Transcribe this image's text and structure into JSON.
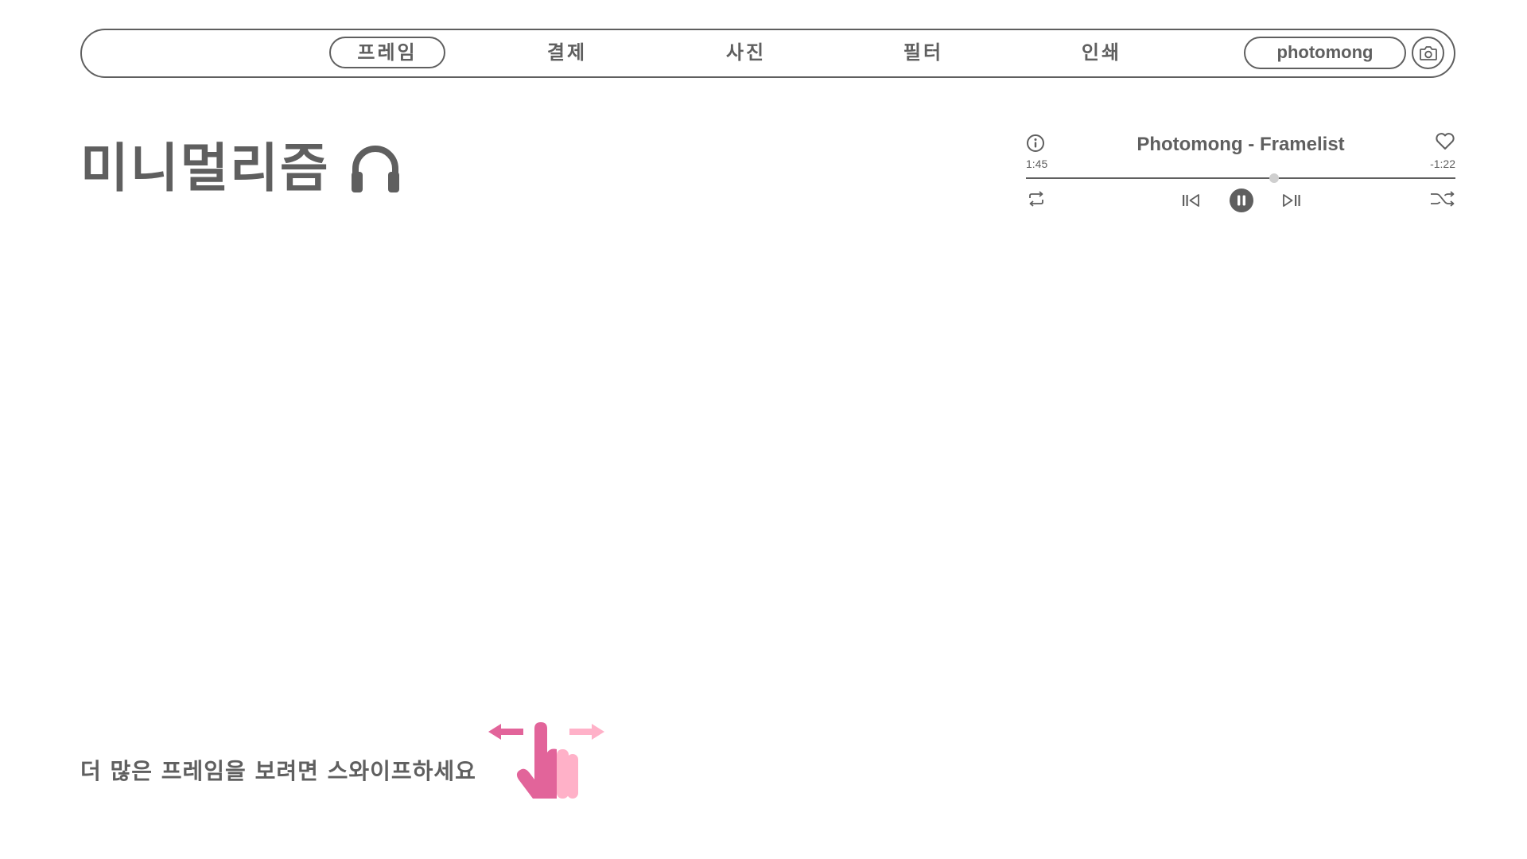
{
  "nav": {
    "items": [
      {
        "label": "프레임",
        "active": true
      },
      {
        "label": "결제",
        "active": false
      },
      {
        "label": "사진",
        "active": false
      },
      {
        "label": "필터",
        "active": false
      },
      {
        "label": "인쇄",
        "active": false
      }
    ],
    "brand_label": "photomong",
    "camera_icon": "camera-icon"
  },
  "main": {
    "title": "미니멀리즘",
    "title_icon": "headphones-icon"
  },
  "player": {
    "track_title": "Photomong - Framelist",
    "time_elapsed": "1:45",
    "time_remaining": "-1:22",
    "progress": 0.577,
    "icons": {
      "info": "info-icon",
      "favorite": "heart-icon",
      "repeat": "repeat-icon",
      "previous": "skip-previous-icon",
      "pause": "pause-icon",
      "next": "skip-next-icon",
      "shuffle": "shuffle-icon"
    }
  },
  "swipe_hint": {
    "text": "더 많은 프레임을 보려면 스와이프하세요",
    "icon": "swipe-gesture-icon"
  },
  "colors": {
    "primary": "#5f5f5f",
    "thumb": "#cfcfcf",
    "accent_dark_pink": "#e2649a",
    "accent_light_pink": "#ffb1c8",
    "background": "#ffffff"
  }
}
